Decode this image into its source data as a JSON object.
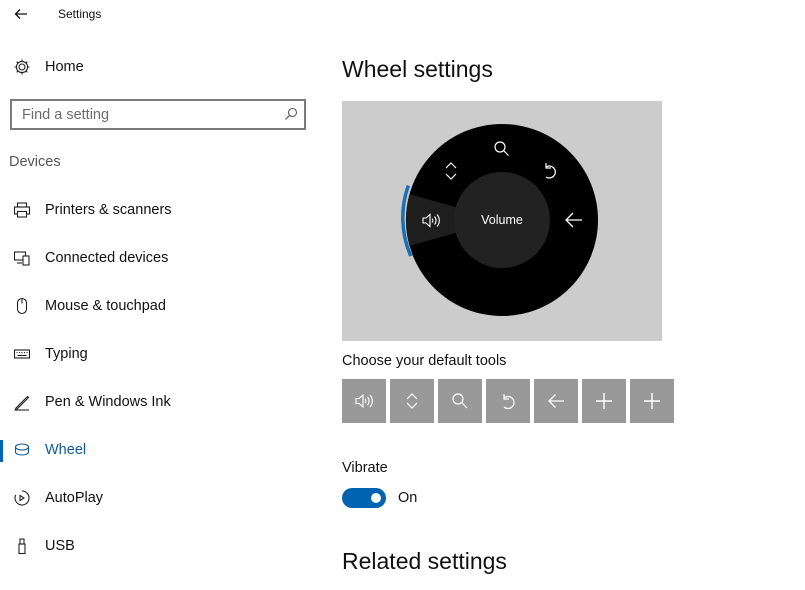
{
  "window": {
    "title": "Settings"
  },
  "sidebar": {
    "home_label": "Home",
    "search": {
      "placeholder": "Find a setting",
      "value": ""
    },
    "section_label": "Devices",
    "items": [
      {
        "label": "Printers & scanners",
        "icon": "printer-icon",
        "active": false
      },
      {
        "label": "Connected devices",
        "icon": "connected-devices-icon",
        "active": false
      },
      {
        "label": "Mouse & touchpad",
        "icon": "mouse-icon",
        "active": false
      },
      {
        "label": "Typing",
        "icon": "keyboard-icon",
        "active": false
      },
      {
        "label": "Pen & Windows Ink",
        "icon": "pen-icon",
        "active": false
      },
      {
        "label": "Wheel",
        "icon": "wheel-icon",
        "active": true
      },
      {
        "label": "AutoPlay",
        "icon": "autoplay-icon",
        "active": false
      },
      {
        "label": "USB",
        "icon": "usb-icon",
        "active": false
      }
    ]
  },
  "main": {
    "page_title": "Wheel settings",
    "wheel_preview": {
      "center_label": "Volume",
      "tools": [
        "volume-icon",
        "scroll-icon",
        "zoom-icon",
        "undo-icon",
        "back-arrow-icon"
      ],
      "selected_tool": "volume-icon"
    },
    "tools_label": "Choose your default tools",
    "tool_buttons": [
      "volume-icon",
      "scroll-icon",
      "zoom-icon",
      "undo-icon",
      "back-arrow-icon",
      "add-icon",
      "add-icon"
    ],
    "vibrate": {
      "label": "Vibrate",
      "state": "On",
      "enabled": true
    },
    "related_title": "Related settings"
  },
  "colors": {
    "accent": "#0063b1",
    "wheel_bg": "#cccccc",
    "tool_button_bg": "#999999",
    "dial": "#000000",
    "dial_center": "#222222"
  }
}
